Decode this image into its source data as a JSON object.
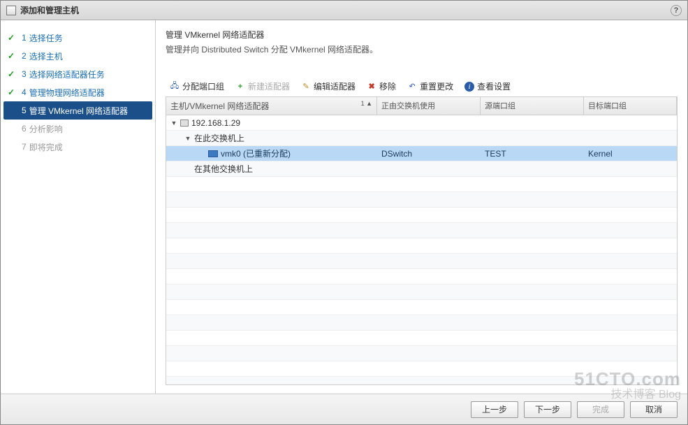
{
  "title": "添加和管理主机",
  "help_tooltip": "帮助",
  "steps": [
    {
      "num": "1",
      "label": "选择任务",
      "state": "done"
    },
    {
      "num": "2",
      "label": "选择主机",
      "state": "done"
    },
    {
      "num": "3",
      "label": "选择网络适配器任务",
      "state": "done"
    },
    {
      "num": "4",
      "label": "管理物理网络适配器",
      "state": "done"
    },
    {
      "num": "5",
      "label": "管理 VMkernel 网络适配器",
      "state": "active"
    },
    {
      "num": "6",
      "label": "分析影响",
      "state": "pending"
    },
    {
      "num": "7",
      "label": "即将完成",
      "state": "pending"
    }
  ],
  "heading": "管理 VMkernel 网络适配器",
  "subheading": "管理并向 Distributed Switch 分配 VMkernel 网络适配器。",
  "toolbar": {
    "assign": "分配端口组",
    "new": "新建适配器",
    "edit": "编辑适配器",
    "remove": "移除",
    "reset": "重置更改",
    "view": "查看设置"
  },
  "columns": {
    "c1": "主机/VMkernel 网络适配器",
    "c1_sort": "1 ▲",
    "c2": "正由交换机使用",
    "c3": "源端口组",
    "c4": "目标端口组"
  },
  "rows": [
    {
      "type": "host",
      "indent": 0,
      "toggle": "▼",
      "icon": "host",
      "label": "192.168.1.29",
      "c2": "",
      "c3": "",
      "c4": "",
      "selected": false
    },
    {
      "type": "group",
      "indent": 1,
      "toggle": "▼",
      "icon": "",
      "label": "在此交换机上",
      "c2": "",
      "c3": "",
      "c4": "",
      "selected": false
    },
    {
      "type": "nic",
      "indent": 2,
      "toggle": "",
      "icon": "nic",
      "label": "vmk0 (已重新分配)",
      "c2": "DSwitch",
      "c3": "TEST",
      "c4": "Kernel",
      "selected": true
    },
    {
      "type": "group",
      "indent": 1,
      "toggle": "",
      "icon": "",
      "label": "在其他交换机上",
      "c2": "",
      "c3": "",
      "c4": "",
      "selected": false
    }
  ],
  "footer": {
    "back": "上一步",
    "next": "下一步",
    "finish": "完成",
    "cancel": "取消"
  },
  "watermark": {
    "l1": "51CTO.com",
    "l2": "技术博客  Blog"
  }
}
